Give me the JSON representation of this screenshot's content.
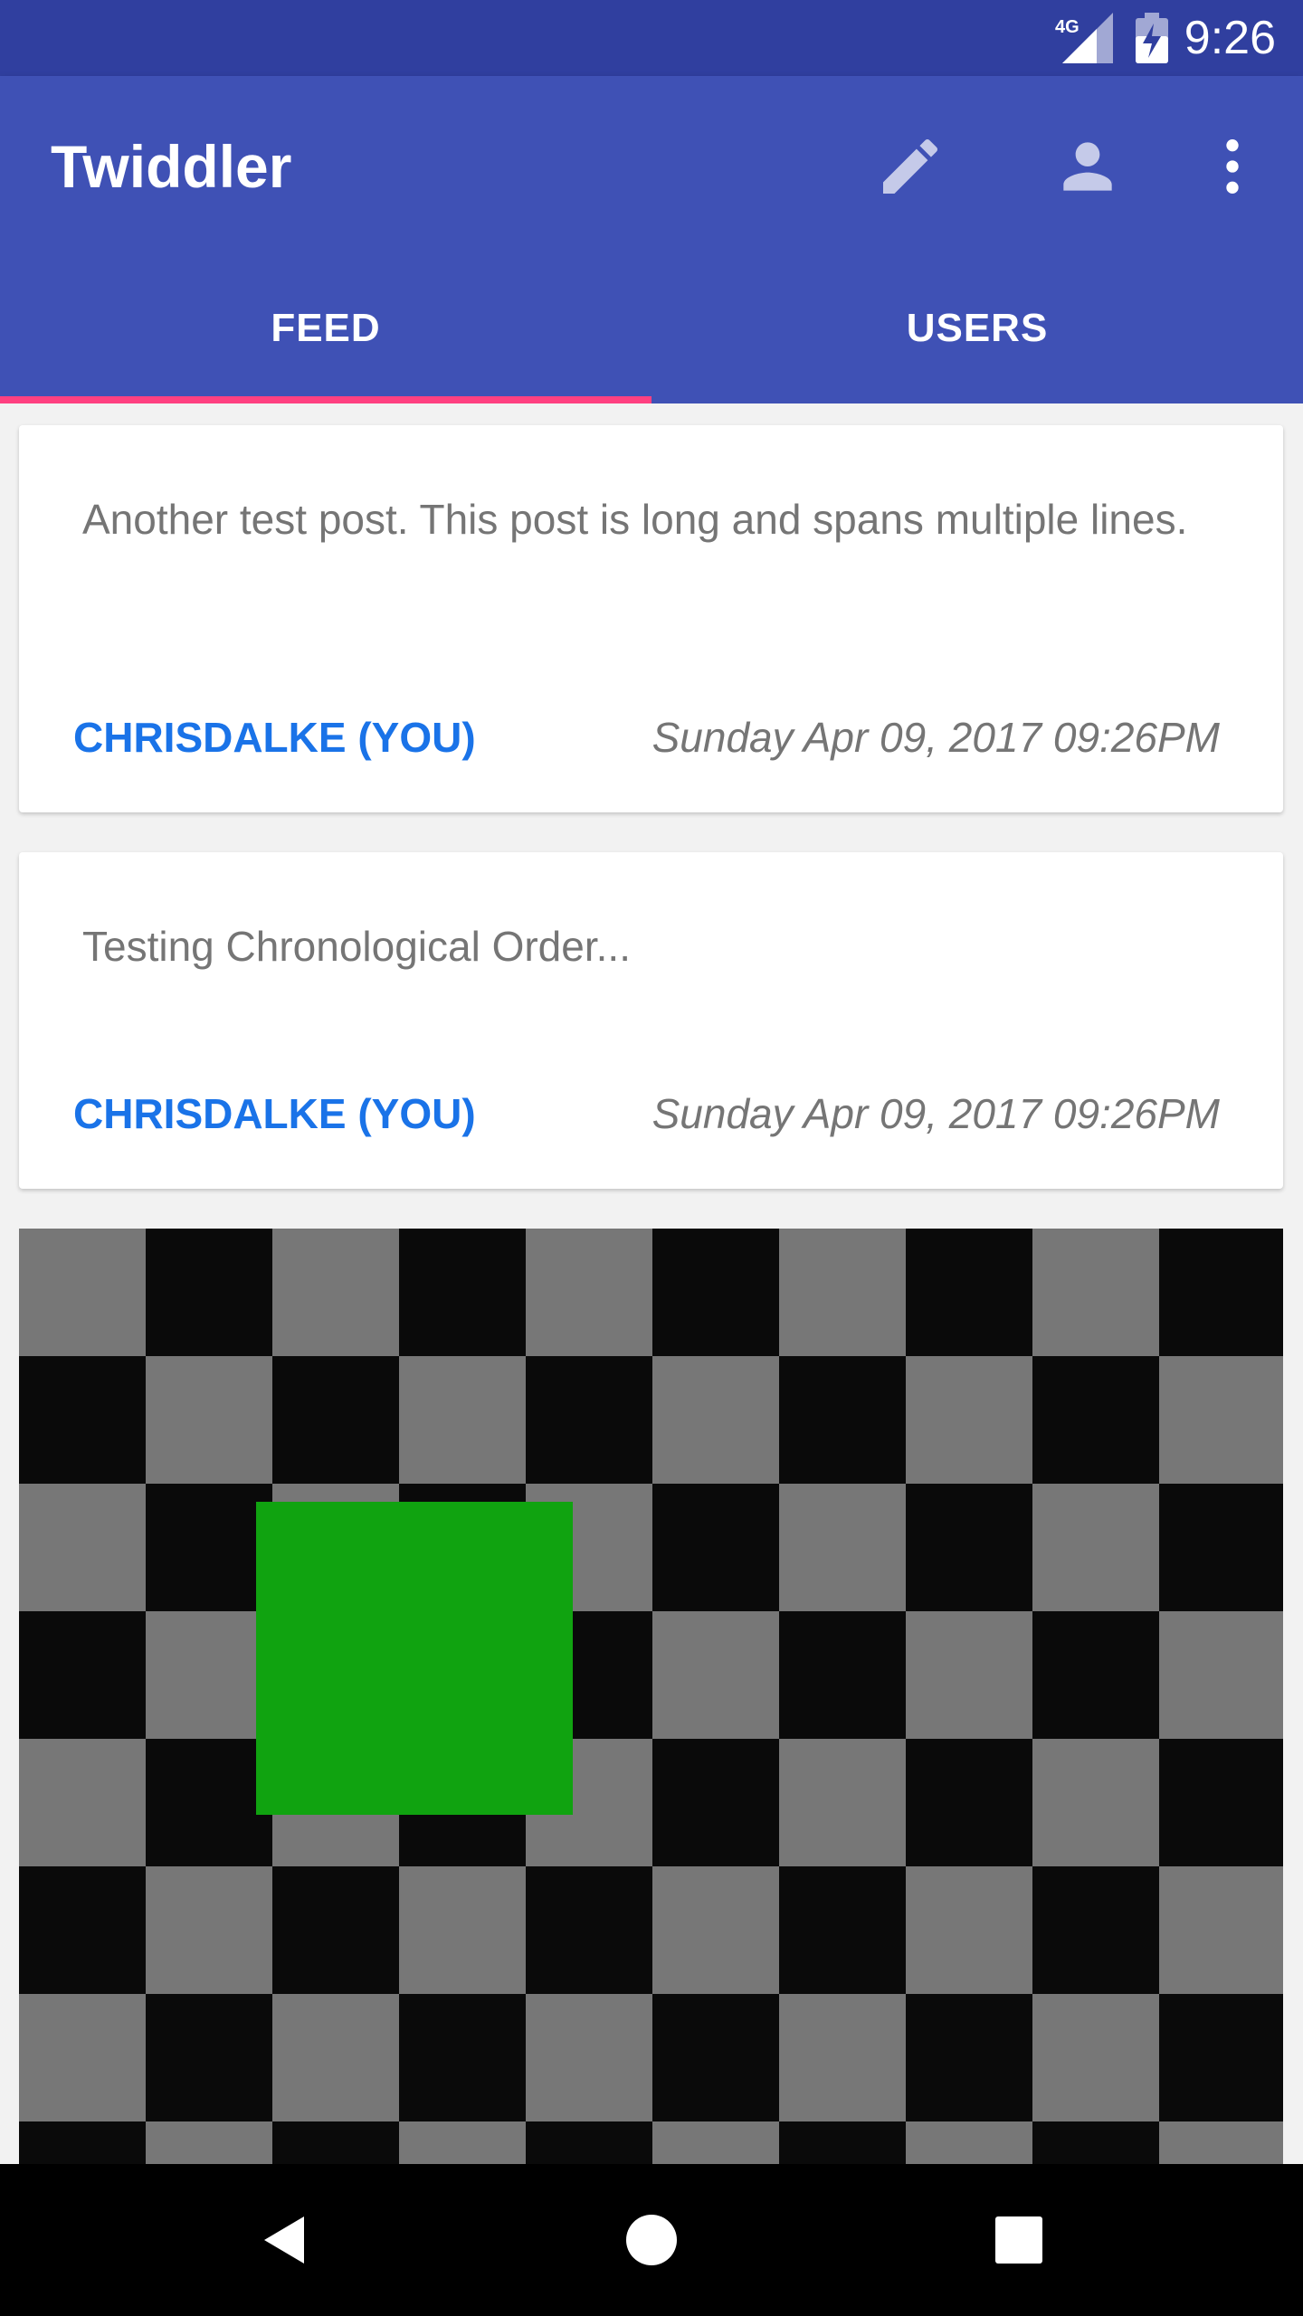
{
  "status_bar": {
    "time": "9:26",
    "network_label": "4G"
  },
  "app_bar": {
    "title": "Twiddler",
    "icons": [
      "edit-icon",
      "profile-icon",
      "more-vert-icon"
    ]
  },
  "tabs": [
    {
      "label": "FEED",
      "selected": true
    },
    {
      "label": "USERS",
      "selected": false
    }
  ],
  "posts": [
    {
      "text": "Another test post. This post is long and spans multiple lines.",
      "author": "CHRISDALKE (YOU)",
      "timestamp": "Sunday Apr 09, 2017 09:26PM"
    },
    {
      "text": "Testing Chronological Order...",
      "author": "CHRISDALKE (YOU)",
      "timestamp": "Sunday Apr 09, 2017 09:26PM"
    }
  ],
  "colors": {
    "primary": "#3f51b5",
    "primary_dark": "#303f9f",
    "accent": "#ff4081",
    "author_link": "#1a73e8"
  },
  "nav": {
    "icons": [
      "back-icon",
      "home-icon",
      "recents-icon"
    ]
  }
}
